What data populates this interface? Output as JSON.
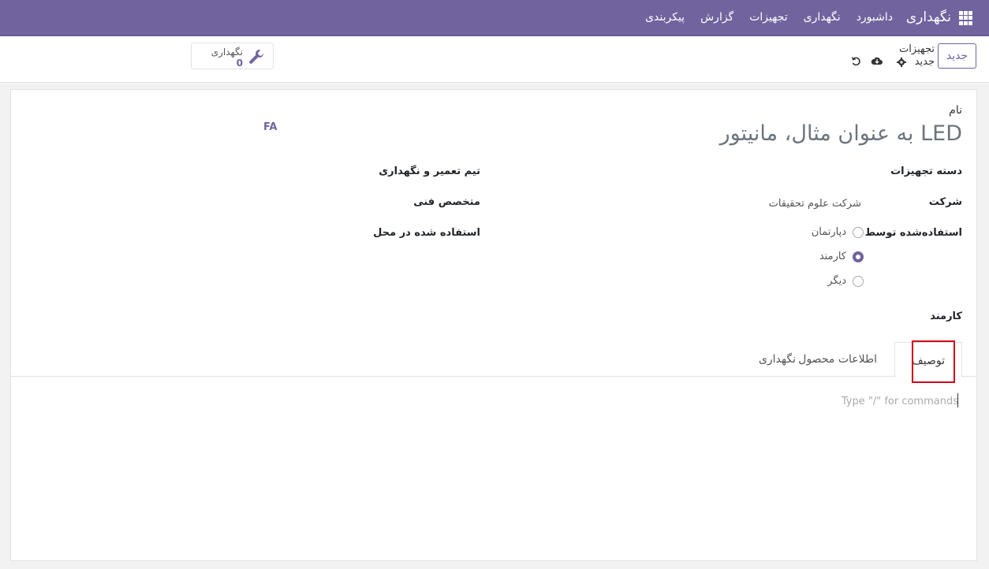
{
  "topbar": {
    "app_name": "نگهداری",
    "menu": [
      "داشبورد",
      "نگهداری",
      "تجهیزات",
      "گزارش",
      "پیکربندی"
    ]
  },
  "control": {
    "new_button": "جدید",
    "breadcrumb_parent": "تجهیزات",
    "breadcrumb_current": "جدید",
    "stat_label": "نگهداری",
    "stat_value": "0"
  },
  "form": {
    "name_label": "نام",
    "name_placeholder": "به عنوان مثال، مانیتور LED",
    "fa_badge": "FA",
    "category_label": "دسته تجهیزات",
    "company_label": "شرکت",
    "company_value": "شرکت علوم تحقیقات",
    "used_by_label": "استفاده‌شده توسط",
    "used_by_options": [
      "دپارتمان",
      "کارمند",
      "دیگر"
    ],
    "used_by_selected": "کارمند",
    "employee_label": "کارمند",
    "team_label": "تیم تعمیر و نگهداری",
    "technician_label": "متخصص فنی",
    "location_label": "استفاده شده در محل"
  },
  "tabs": [
    "توصیف",
    "اطلاعات محصول",
    "نگهداری"
  ],
  "editor": {
    "placeholder": "Type \"/\" for commands"
  }
}
